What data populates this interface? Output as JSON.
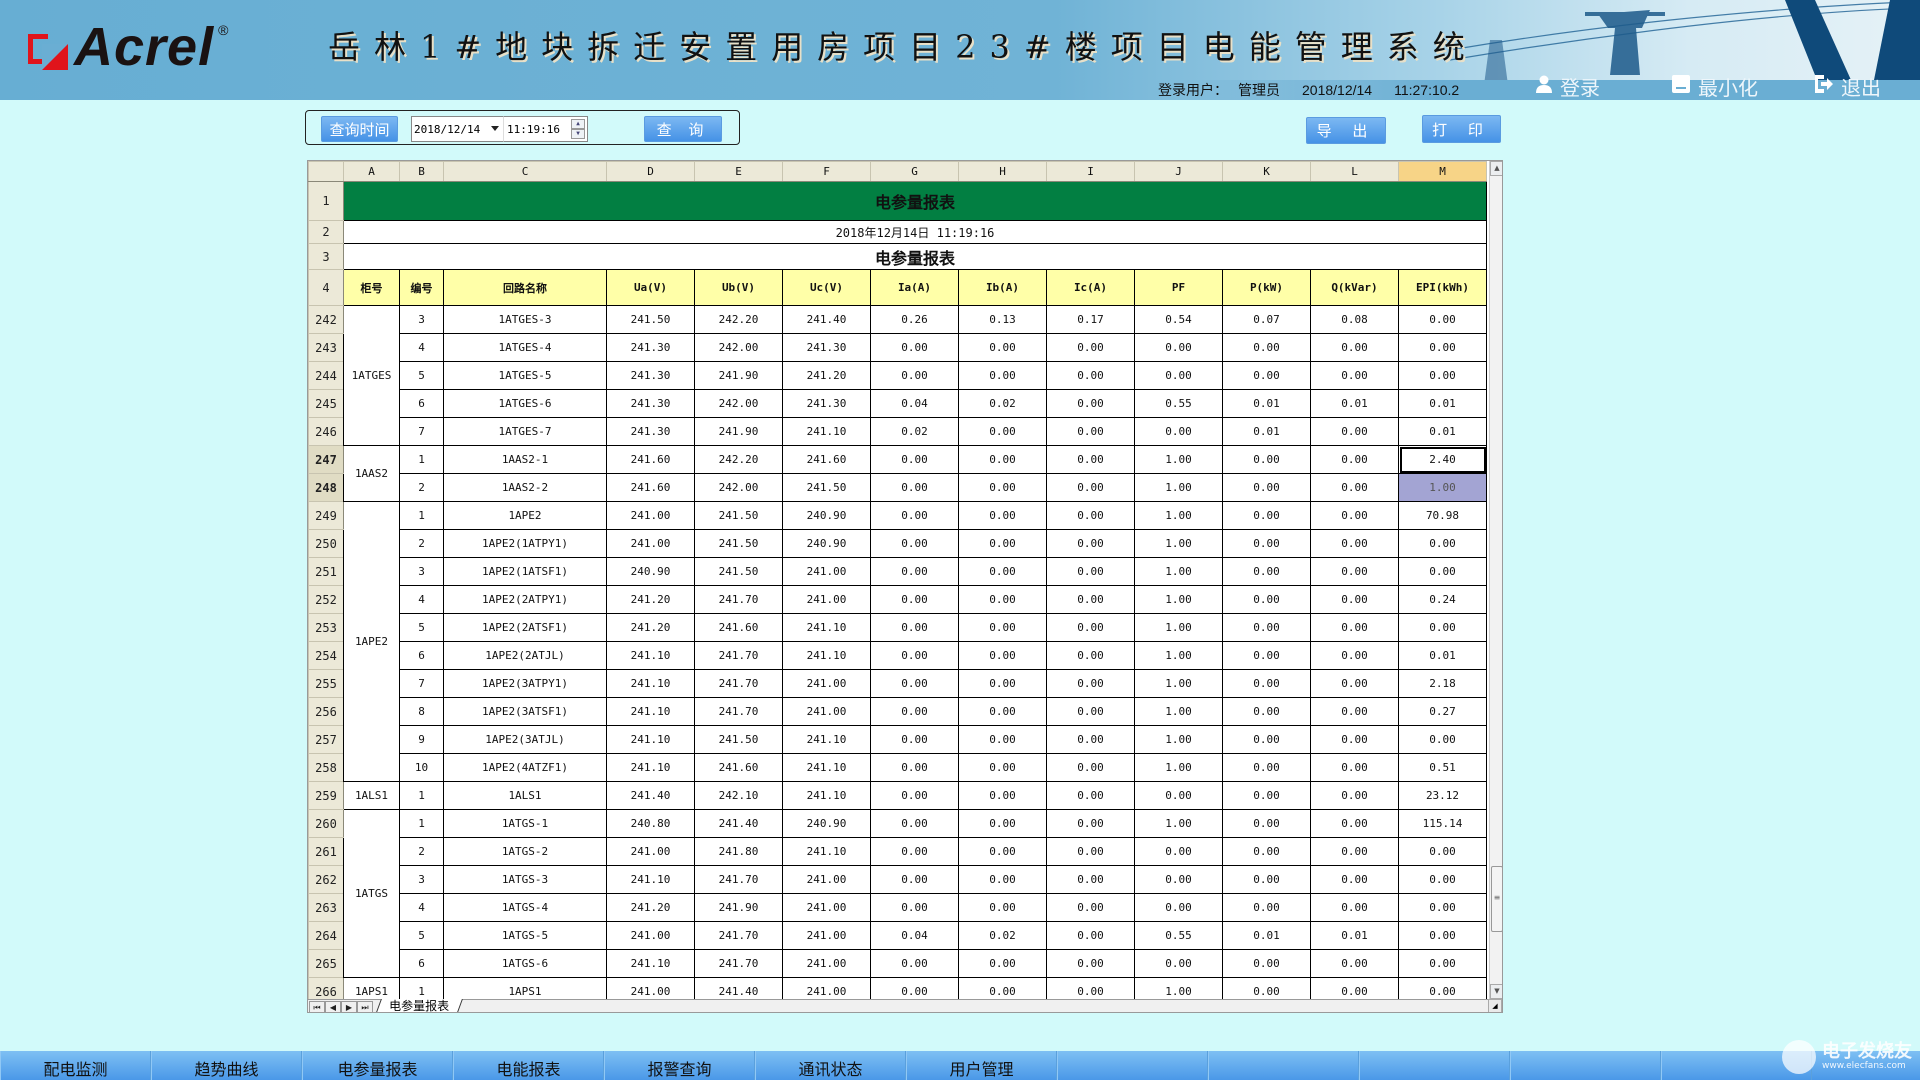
{
  "header": {
    "logo_text": "Acrel",
    "logo_reg": "®",
    "system_title": "岳林1#地块拆迁安置用房项目23#楼项目电能管理系统",
    "login_user_label": "登录用户：",
    "login_user": "管理员",
    "date": "2018/12/14",
    "time": "11:27:10.2",
    "buttons": {
      "login": "登录",
      "minimize": "最小化",
      "exit": "退出"
    }
  },
  "query": {
    "label": "查询时间",
    "date_value": "2018/12/14",
    "time_value": "11:19:16",
    "query_button": "查 询",
    "export_button": "导 出",
    "print_button": "打 印"
  },
  "sheet": {
    "columns": [
      "A",
      "B",
      "C",
      "D",
      "E",
      "F",
      "G",
      "H",
      "I",
      "J",
      "K",
      "L",
      "M"
    ],
    "title": "电参量报表",
    "subtitle": "2018年12月14日 11:19:16",
    "title2": "电参量报表",
    "top_row_numbers": [
      "1",
      "2",
      "3",
      "4"
    ],
    "headers": [
      "柜号",
      "编号",
      "回路名称",
      "Ua(V)",
      "Ub(V)",
      "Uc(V)",
      "Ia(A)",
      "Ib(A)",
      "Ic(A)",
      "PF",
      "P(kW)",
      "Q(kVar)",
      "EPI(kWh)"
    ],
    "groups": [
      {
        "cabinet": "1ATGES",
        "rows": [
          {
            "row": "242",
            "no": "3",
            "name": "1ATGES-3",
            "vals": [
              "241.50",
              "242.20",
              "241.40",
              "0.26",
              "0.13",
              "0.17",
              "0.54",
              "0.07",
              "0.08",
              "0.00"
            ]
          },
          {
            "row": "243",
            "no": "4",
            "name": "1ATGES-4",
            "vals": [
              "241.30",
              "242.00",
              "241.30",
              "0.00",
              "0.00",
              "0.00",
              "0.00",
              "0.00",
              "0.00",
              "0.00"
            ]
          },
          {
            "row": "244",
            "no": "5",
            "name": "1ATGES-5",
            "vals": [
              "241.30",
              "241.90",
              "241.20",
              "0.00",
              "0.00",
              "0.00",
              "0.00",
              "0.00",
              "0.00",
              "0.00"
            ]
          },
          {
            "row": "245",
            "no": "6",
            "name": "1ATGES-6",
            "vals": [
              "241.30",
              "242.00",
              "241.30",
              "0.04",
              "0.02",
              "0.00",
              "0.55",
              "0.01",
              "0.01",
              "0.01"
            ]
          },
          {
            "row": "246",
            "no": "7",
            "name": "1ATGES-7",
            "vals": [
              "241.30",
              "241.90",
              "241.10",
              "0.02",
              "0.00",
              "0.00",
              "0.00",
              "0.01",
              "0.00",
              "0.01"
            ]
          }
        ]
      },
      {
        "cabinet": "1AAS2",
        "rows": [
          {
            "row": "247",
            "no": "1",
            "name": "1AAS2-1",
            "vals": [
              "241.60",
              "242.20",
              "241.60",
              "0.00",
              "0.00",
              "0.00",
              "1.00",
              "0.00",
              "0.00",
              "2.40"
            ],
            "selected_row": true
          },
          {
            "row": "248",
            "no": "2",
            "name": "1AAS2-2",
            "vals": [
              "241.60",
              "242.00",
              "241.50",
              "0.00",
              "0.00",
              "0.00",
              "1.00",
              "0.00",
              "0.00",
              "1.00"
            ],
            "selected_row": true
          }
        ]
      },
      {
        "cabinet": "1APE2",
        "rows": [
          {
            "row": "249",
            "no": "1",
            "name": "1APE2",
            "vals": [
              "241.00",
              "241.50",
              "240.90",
              "0.00",
              "0.00",
              "0.00",
              "1.00",
              "0.00",
              "0.00",
              "70.98"
            ]
          },
          {
            "row": "250",
            "no": "2",
            "name": "1APE2(1ATPY1)",
            "vals": [
              "241.00",
              "241.50",
              "240.90",
              "0.00",
              "0.00",
              "0.00",
              "1.00",
              "0.00",
              "0.00",
              "0.00"
            ]
          },
          {
            "row": "251",
            "no": "3",
            "name": "1APE2(1ATSF1)",
            "vals": [
              "240.90",
              "241.50",
              "241.00",
              "0.00",
              "0.00",
              "0.00",
              "1.00",
              "0.00",
              "0.00",
              "0.00"
            ]
          },
          {
            "row": "252",
            "no": "4",
            "name": "1APE2(2ATPY1)",
            "vals": [
              "241.20",
              "241.70",
              "241.00",
              "0.00",
              "0.00",
              "0.00",
              "1.00",
              "0.00",
              "0.00",
              "0.24"
            ]
          },
          {
            "row": "253",
            "no": "5",
            "name": "1APE2(2ATSF1)",
            "vals": [
              "241.20",
              "241.60",
              "241.10",
              "0.00",
              "0.00",
              "0.00",
              "1.00",
              "0.00",
              "0.00",
              "0.00"
            ]
          },
          {
            "row": "254",
            "no": "6",
            "name": "1APE2(2ATJL)",
            "vals": [
              "241.10",
              "241.70",
              "241.10",
              "0.00",
              "0.00",
              "0.00",
              "1.00",
              "0.00",
              "0.00",
              "0.01"
            ]
          },
          {
            "row": "255",
            "no": "7",
            "name": "1APE2(3ATPY1)",
            "vals": [
              "241.10",
              "241.70",
              "241.00",
              "0.00",
              "0.00",
              "0.00",
              "1.00",
              "0.00",
              "0.00",
              "2.18"
            ]
          },
          {
            "row": "256",
            "no": "8",
            "name": "1APE2(3ATSF1)",
            "vals": [
              "241.10",
              "241.70",
              "241.00",
              "0.00",
              "0.00",
              "0.00",
              "1.00",
              "0.00",
              "0.00",
              "0.27"
            ]
          },
          {
            "row": "257",
            "no": "9",
            "name": "1APE2(3ATJL)",
            "vals": [
              "241.10",
              "241.50",
              "241.10",
              "0.00",
              "0.00",
              "0.00",
              "1.00",
              "0.00",
              "0.00",
              "0.00"
            ]
          },
          {
            "row": "258",
            "no": "10",
            "name": "1APE2(4ATZF1)",
            "vals": [
              "241.10",
              "241.60",
              "241.10",
              "0.00",
              "0.00",
              "0.00",
              "1.00",
              "0.00",
              "0.00",
              "0.51"
            ]
          }
        ]
      },
      {
        "cabinet": "1ALS1",
        "rows": [
          {
            "row": "259",
            "no": "1",
            "name": "1ALS1",
            "vals": [
              "241.40",
              "242.10",
              "241.10",
              "0.00",
              "0.00",
              "0.00",
              "0.00",
              "0.00",
              "0.00",
              "23.12"
            ]
          }
        ]
      },
      {
        "cabinet": "1ATGS",
        "rows": [
          {
            "row": "260",
            "no": "1",
            "name": "1ATGS-1",
            "vals": [
              "240.80",
              "241.40",
              "240.90",
              "0.00",
              "0.00",
              "0.00",
              "1.00",
              "0.00",
              "0.00",
              "115.14"
            ]
          },
          {
            "row": "261",
            "no": "2",
            "name": "1ATGS-2",
            "vals": [
              "241.00",
              "241.80",
              "241.10",
              "0.00",
              "0.00",
              "0.00",
              "0.00",
              "0.00",
              "0.00",
              "0.00"
            ]
          },
          {
            "row": "262",
            "no": "3",
            "name": "1ATGS-3",
            "vals": [
              "241.10",
              "241.70",
              "241.00",
              "0.00",
              "0.00",
              "0.00",
              "0.00",
              "0.00",
              "0.00",
              "0.00"
            ]
          },
          {
            "row": "263",
            "no": "4",
            "name": "1ATGS-4",
            "vals": [
              "241.20",
              "241.90",
              "241.00",
              "0.00",
              "0.00",
              "0.00",
              "0.00",
              "0.00",
              "0.00",
              "0.00"
            ]
          },
          {
            "row": "264",
            "no": "5",
            "name": "1ATGS-5",
            "vals": [
              "241.00",
              "241.70",
              "241.00",
              "0.04",
              "0.02",
              "0.00",
              "0.55",
              "0.01",
              "0.01",
              "0.00"
            ]
          },
          {
            "row": "265",
            "no": "6",
            "name": "1ATGS-6",
            "vals": [
              "241.10",
              "241.70",
              "241.00",
              "0.00",
              "0.00",
              "0.00",
              "0.00",
              "0.00",
              "0.00",
              "0.00"
            ]
          }
        ]
      },
      {
        "cabinet": "1APS1",
        "rows": [
          {
            "row": "266",
            "no": "1",
            "name": "1APS1",
            "vals": [
              "241.00",
              "241.40",
              "241.00",
              "0.00",
              "0.00",
              "0.00",
              "1.00",
              "0.00",
              "0.00",
              "0.00"
            ]
          }
        ]
      }
    ],
    "active_cell": {
      "row": "247",
      "col": "M"
    },
    "selected_cell": {
      "row": "248",
      "col": "M"
    },
    "sheet_tab": "电参量报表",
    "selection_color": "#a3a4d3",
    "title_bg_color": "#027f42",
    "header_bg_color": "#ffffa8"
  },
  "bottom_nav": {
    "items": [
      "配电监测",
      "趋势曲线",
      "电参量报表",
      "电能报表",
      "报警查询",
      "通讯状态",
      "用户管理",
      "",
      "",
      "",
      "",
      ""
    ]
  },
  "watermark": {
    "text": "电子发烧友",
    "url": "www.elecfans.com"
  }
}
